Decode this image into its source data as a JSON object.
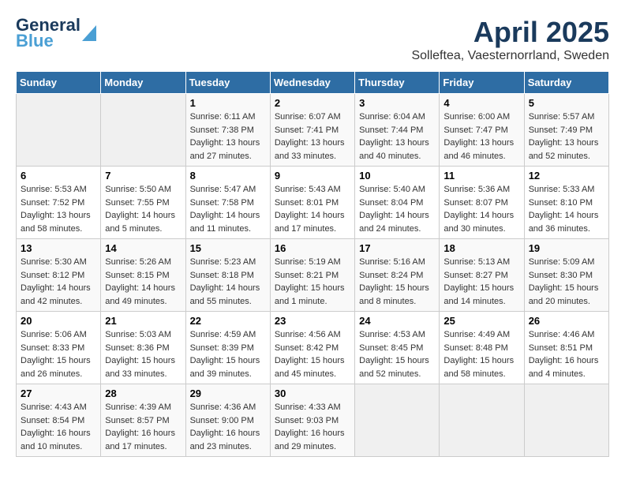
{
  "logo": {
    "line1": "General",
    "line2": "Blue"
  },
  "title": "April 2025",
  "subtitle": "Solleftea, Vaesternorrland, Sweden",
  "days_of_week": [
    "Sunday",
    "Monday",
    "Tuesday",
    "Wednesday",
    "Thursday",
    "Friday",
    "Saturday"
  ],
  "weeks": [
    [
      {
        "day": "",
        "info": ""
      },
      {
        "day": "",
        "info": ""
      },
      {
        "day": "1",
        "info": "Sunrise: 6:11 AM\nSunset: 7:38 PM\nDaylight: 13 hours and 27 minutes."
      },
      {
        "day": "2",
        "info": "Sunrise: 6:07 AM\nSunset: 7:41 PM\nDaylight: 13 hours and 33 minutes."
      },
      {
        "day": "3",
        "info": "Sunrise: 6:04 AM\nSunset: 7:44 PM\nDaylight: 13 hours and 40 minutes."
      },
      {
        "day": "4",
        "info": "Sunrise: 6:00 AM\nSunset: 7:47 PM\nDaylight: 13 hours and 46 minutes."
      },
      {
        "day": "5",
        "info": "Sunrise: 5:57 AM\nSunset: 7:49 PM\nDaylight: 13 hours and 52 minutes."
      }
    ],
    [
      {
        "day": "6",
        "info": "Sunrise: 5:53 AM\nSunset: 7:52 PM\nDaylight: 13 hours and 58 minutes."
      },
      {
        "day": "7",
        "info": "Sunrise: 5:50 AM\nSunset: 7:55 PM\nDaylight: 14 hours and 5 minutes."
      },
      {
        "day": "8",
        "info": "Sunrise: 5:47 AM\nSunset: 7:58 PM\nDaylight: 14 hours and 11 minutes."
      },
      {
        "day": "9",
        "info": "Sunrise: 5:43 AM\nSunset: 8:01 PM\nDaylight: 14 hours and 17 minutes."
      },
      {
        "day": "10",
        "info": "Sunrise: 5:40 AM\nSunset: 8:04 PM\nDaylight: 14 hours and 24 minutes."
      },
      {
        "day": "11",
        "info": "Sunrise: 5:36 AM\nSunset: 8:07 PM\nDaylight: 14 hours and 30 minutes."
      },
      {
        "day": "12",
        "info": "Sunrise: 5:33 AM\nSunset: 8:10 PM\nDaylight: 14 hours and 36 minutes."
      }
    ],
    [
      {
        "day": "13",
        "info": "Sunrise: 5:30 AM\nSunset: 8:12 PM\nDaylight: 14 hours and 42 minutes."
      },
      {
        "day": "14",
        "info": "Sunrise: 5:26 AM\nSunset: 8:15 PM\nDaylight: 14 hours and 49 minutes."
      },
      {
        "day": "15",
        "info": "Sunrise: 5:23 AM\nSunset: 8:18 PM\nDaylight: 14 hours and 55 minutes."
      },
      {
        "day": "16",
        "info": "Sunrise: 5:19 AM\nSunset: 8:21 PM\nDaylight: 15 hours and 1 minute."
      },
      {
        "day": "17",
        "info": "Sunrise: 5:16 AM\nSunset: 8:24 PM\nDaylight: 15 hours and 8 minutes."
      },
      {
        "day": "18",
        "info": "Sunrise: 5:13 AM\nSunset: 8:27 PM\nDaylight: 15 hours and 14 minutes."
      },
      {
        "day": "19",
        "info": "Sunrise: 5:09 AM\nSunset: 8:30 PM\nDaylight: 15 hours and 20 minutes."
      }
    ],
    [
      {
        "day": "20",
        "info": "Sunrise: 5:06 AM\nSunset: 8:33 PM\nDaylight: 15 hours and 26 minutes."
      },
      {
        "day": "21",
        "info": "Sunrise: 5:03 AM\nSunset: 8:36 PM\nDaylight: 15 hours and 33 minutes."
      },
      {
        "day": "22",
        "info": "Sunrise: 4:59 AM\nSunset: 8:39 PM\nDaylight: 15 hours and 39 minutes."
      },
      {
        "day": "23",
        "info": "Sunrise: 4:56 AM\nSunset: 8:42 PM\nDaylight: 15 hours and 45 minutes."
      },
      {
        "day": "24",
        "info": "Sunrise: 4:53 AM\nSunset: 8:45 PM\nDaylight: 15 hours and 52 minutes."
      },
      {
        "day": "25",
        "info": "Sunrise: 4:49 AM\nSunset: 8:48 PM\nDaylight: 15 hours and 58 minutes."
      },
      {
        "day": "26",
        "info": "Sunrise: 4:46 AM\nSunset: 8:51 PM\nDaylight: 16 hours and 4 minutes."
      }
    ],
    [
      {
        "day": "27",
        "info": "Sunrise: 4:43 AM\nSunset: 8:54 PM\nDaylight: 16 hours and 10 minutes."
      },
      {
        "day": "28",
        "info": "Sunrise: 4:39 AM\nSunset: 8:57 PM\nDaylight: 16 hours and 17 minutes."
      },
      {
        "day": "29",
        "info": "Sunrise: 4:36 AM\nSunset: 9:00 PM\nDaylight: 16 hours and 23 minutes."
      },
      {
        "day": "30",
        "info": "Sunrise: 4:33 AM\nSunset: 9:03 PM\nDaylight: 16 hours and 29 minutes."
      },
      {
        "day": "",
        "info": ""
      },
      {
        "day": "",
        "info": ""
      },
      {
        "day": "",
        "info": ""
      }
    ]
  ]
}
